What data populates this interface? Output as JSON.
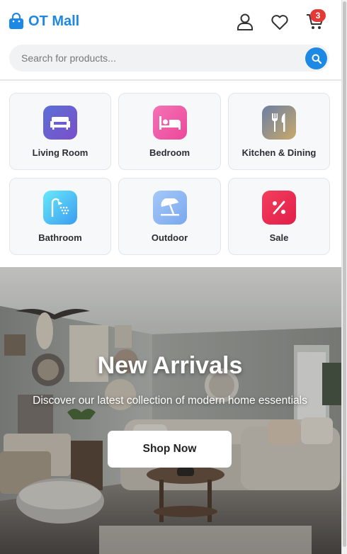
{
  "header": {
    "brand": "OT Mall",
    "cart_count": "3",
    "icons": [
      "shopping-bag-icon",
      "user-icon",
      "heart-icon",
      "cart-icon"
    ]
  },
  "search": {
    "placeholder": "Search for products...",
    "value": ""
  },
  "categories": [
    {
      "label": "Living Room",
      "icon": "sofa-icon",
      "colors": [
        "#5b6fd6",
        "#7b4fc9"
      ]
    },
    {
      "label": "Bedroom",
      "icon": "bed-icon",
      "colors": [
        "#f472b6",
        "#ec4899"
      ]
    },
    {
      "label": "Kitchen & Dining",
      "icon": "utensils-icon",
      "colors": [
        "#6b7fa3",
        "#c9a96a"
      ]
    },
    {
      "label": "Bathroom",
      "icon": "shower-icon",
      "colors": [
        "#67e8f9",
        "#3b9cf1"
      ]
    },
    {
      "label": "Outdoor",
      "icon": "umbrella-beach-icon",
      "colors": [
        "#a5c8f7",
        "#7aa8ef"
      ]
    },
    {
      "label": "Sale",
      "icon": "percent-icon",
      "colors": [
        "#f43f5e",
        "#e11d48"
      ]
    }
  ],
  "hero": {
    "title": "New Arrivals",
    "subtitle": "Discover our latest collection of modern home essentials",
    "cta": "Shop Now"
  },
  "colors": {
    "accent": "#1e88e5",
    "badge": "#e53935"
  }
}
